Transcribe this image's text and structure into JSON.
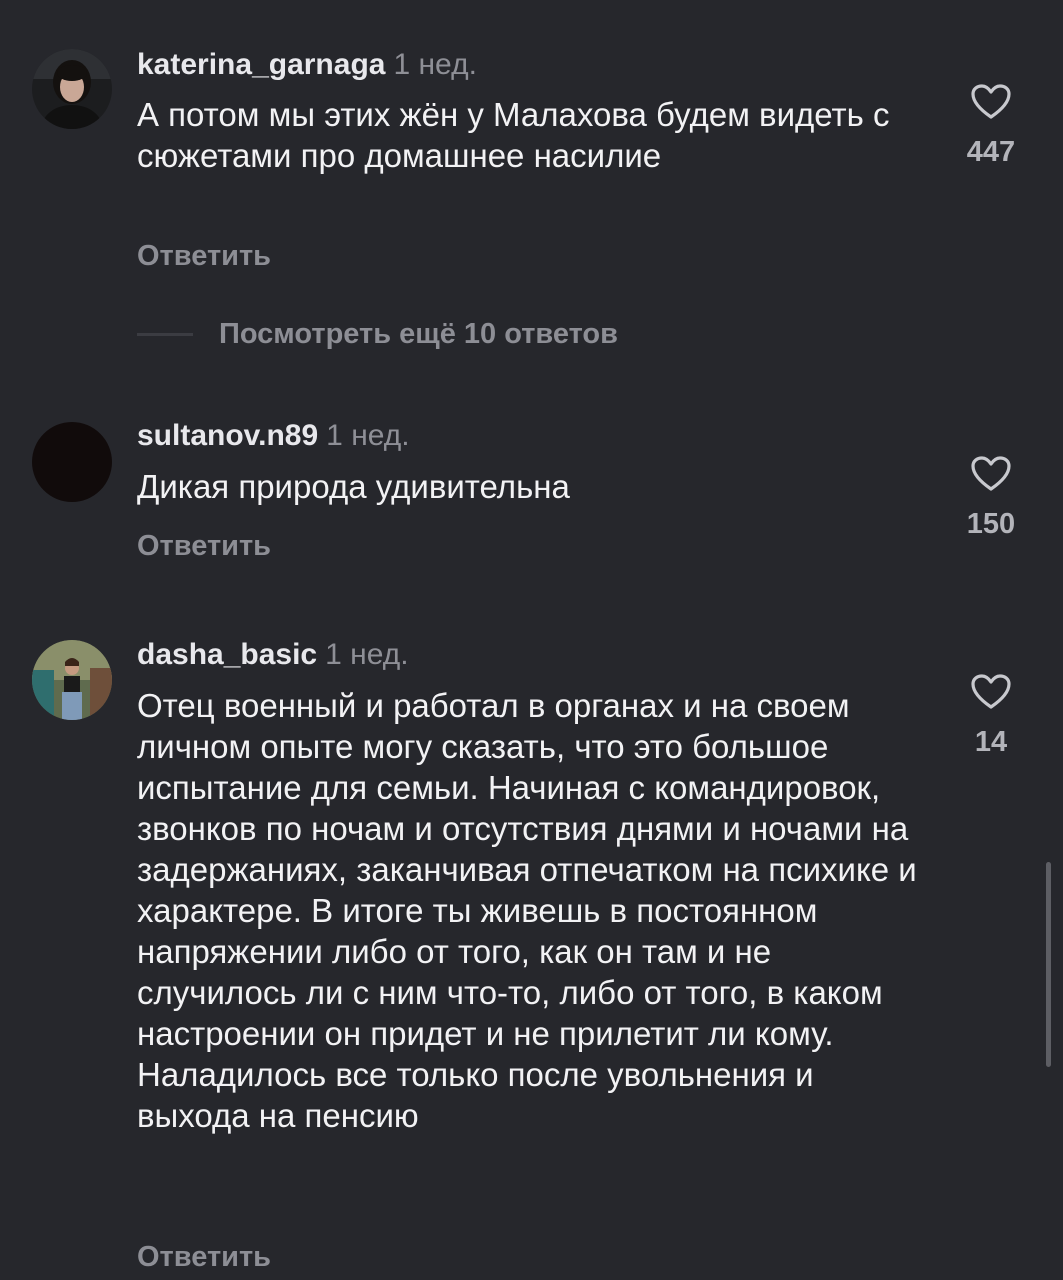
{
  "comments": [
    {
      "username": "katerina_garnaga",
      "time": "1 нед.",
      "text": "А потом мы этих жён у Малахова будем видеть с сюжетами про домашнее насилие",
      "likes": "447",
      "reply_label": "Ответить"
    },
    {
      "username": "sultanov.n89",
      "time": "1 нед.",
      "text": "Дикая природа удивительна",
      "likes": "150",
      "reply_label": "Ответить"
    },
    {
      "username": "dasha_basic",
      "time": "1 нед.",
      "text": "Отец военный и работал в органах и на своем личном опыте могу сказать, что это большое испытание для семьи. Начиная с командировок, звонков по ночам и отсутствия днями и ночами на задержаниях, заканчивая отпечатком на психике и характере. В итоге ты живешь в постоянном напряжении либо от того, как он там и не случилось ли с ним что-то, либо от того, в каком настроении он придет и не прилетит ли кому. Наладилось все только после увольнения и выхода на пенсию",
      "likes": "14",
      "reply_label": "Ответить"
    }
  ],
  "more_replies_label": "Посмотреть ещё 10 ответов",
  "icons": {
    "like": "heart-outline-icon"
  },
  "colors": {
    "background": "#26272c",
    "text": "#f2f2f4",
    "muted": "#8d8e95"
  }
}
